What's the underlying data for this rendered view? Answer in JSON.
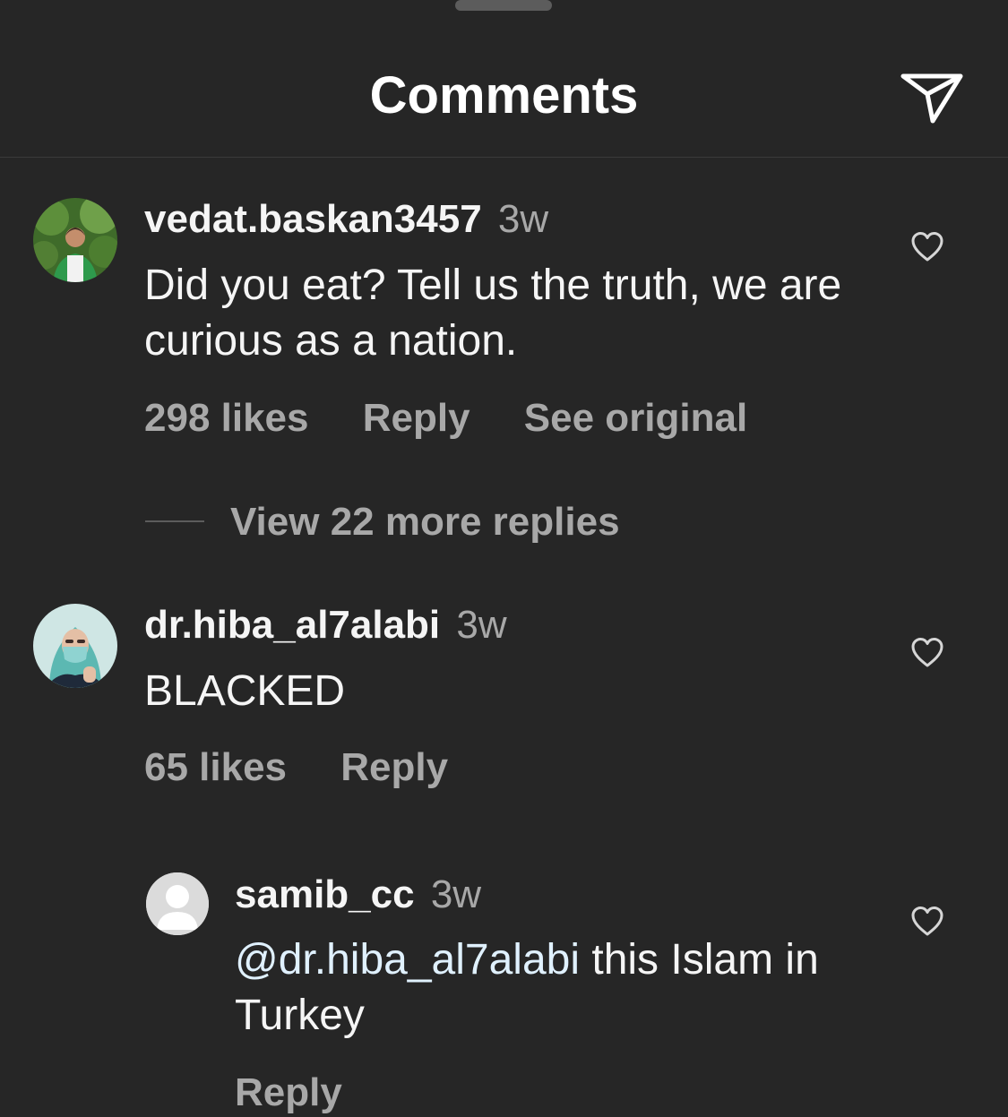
{
  "header": {
    "title": "Comments",
    "share_icon": "paper-plane-icon"
  },
  "comments": [
    {
      "username": "vedat.baskan3457",
      "time": "3w",
      "text": "Did you eat? Tell us the truth, we are curious as a nation.",
      "likes": "298 likes",
      "reply": "Reply",
      "see_original": "See original"
    },
    {
      "username": "dr.hiba_al7alabi",
      "time": "3w",
      "text": "BLACKED",
      "likes": "65 likes",
      "reply": "Reply"
    }
  ],
  "view_replies": "View 22 more replies",
  "reply_comment": {
    "username": "samib_cc",
    "time": "3w",
    "mention": "@dr.hiba_al7alabi",
    "text": " this Islam in Turkey",
    "reply": "Reply"
  },
  "colors": {
    "background": "#262626",
    "secondary_text": "#a8a8a8",
    "mention": "#e0f1ff"
  }
}
